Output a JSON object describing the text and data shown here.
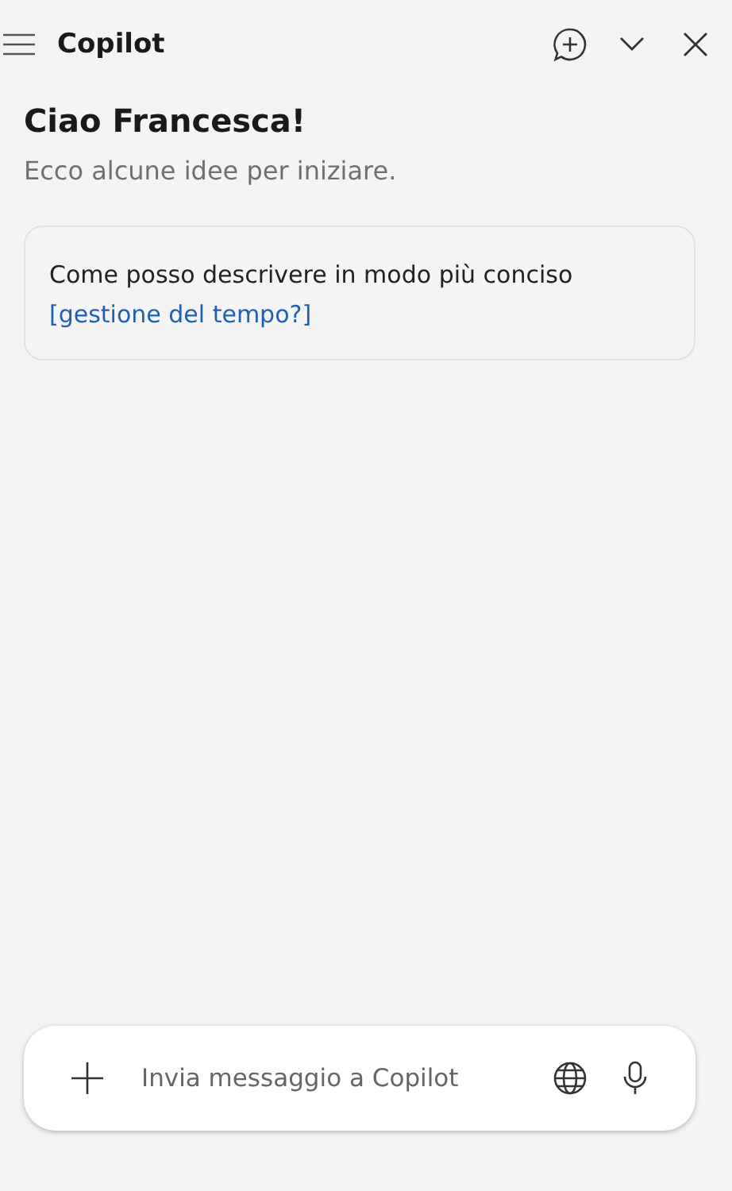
{
  "header": {
    "title": "Copilot"
  },
  "greeting": {
    "title": "Ciao Francesca!",
    "subtitle": "Ecco alcune idee per iniziare."
  },
  "suggestions": [
    {
      "text": "Come posso descrivere in modo più conciso",
      "link": "[gestione del tempo?]"
    }
  ],
  "composer": {
    "placeholder": "Invia messaggio a Copilot"
  }
}
